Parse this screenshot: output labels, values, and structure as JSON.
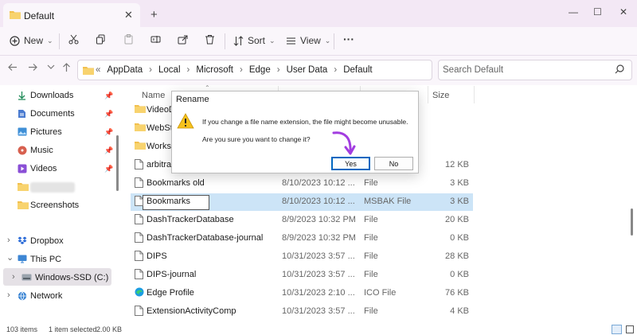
{
  "window": {
    "tab_title": "Default",
    "tab_close": "✕",
    "tab_add": "+",
    "minimize": "—",
    "maximize": "☐",
    "close": "✕"
  },
  "toolbar": {
    "new_label": "New",
    "sort_label": "Sort",
    "view_label": "View",
    "more_label": "···",
    "dropdown_chevron": "⌄"
  },
  "address": {
    "overflow": "«",
    "separator": "›",
    "crumbs": [
      "AppData",
      "Local",
      "Microsoft",
      "Edge",
      "User Data",
      "Default"
    ],
    "search_placeholder": "Search Default"
  },
  "nav": {
    "quick_access": [
      "Downloads",
      "Documents",
      "Pictures",
      "Music",
      "Videos",
      "",
      "Screenshots"
    ],
    "dropbox": "Dropbox",
    "this_pc": "This PC",
    "drive": "Windows-SSD (C:)",
    "network": "Network",
    "expand_glyph": "›",
    "expanded_glyph": "⌄",
    "pin_glyph": "📌"
  },
  "columns": {
    "name": "Name",
    "size": "Size"
  },
  "files": [
    {
      "name": "VideoD",
      "date": "",
      "type": "",
      "size": "",
      "icon": "folder-icon"
    },
    {
      "name": "WebSto",
      "date": "",
      "type": "",
      "size": "",
      "icon": "folder-icon"
    },
    {
      "name": "Worksp",
      "date": "",
      "type": "",
      "size": "",
      "icon": "folder-icon"
    },
    {
      "name": "arbitrat",
      "date": "",
      "type": "",
      "size": "12 KB",
      "icon": "file-icon"
    },
    {
      "name": "Bookmarks old",
      "date": "8/10/2023 10:12 ...",
      "type": "File",
      "size": "3 KB",
      "icon": "file-icon"
    },
    {
      "name": "Bookmarks",
      "date": "8/10/2023 10:12 ...",
      "type": "MSBAK File",
      "size": "3 KB",
      "icon": "file-icon"
    },
    {
      "name": "DashTrackerDatabase",
      "date": "8/9/2023 10:32 PM",
      "type": "File",
      "size": "20 KB",
      "icon": "file-icon"
    },
    {
      "name": "DashTrackerDatabase-journal",
      "date": "8/9/2023 10:32 PM",
      "type": "File",
      "size": "0 KB",
      "icon": "file-icon"
    },
    {
      "name": "DIPS",
      "date": "10/31/2023 3:57 ...",
      "type": "File",
      "size": "28 KB",
      "icon": "file-icon"
    },
    {
      "name": "DIPS-journal",
      "date": "10/31/2023 3:57 ...",
      "type": "File",
      "size": "0 KB",
      "icon": "file-icon"
    },
    {
      "name": "Edge Profile",
      "date": "10/31/2023 2:10 ...",
      "type": "ICO File",
      "size": "76 KB",
      "icon": "edge-icon"
    },
    {
      "name": "ExtensionActivityComp",
      "date": "10/31/2023 3:57 ...",
      "type": "File",
      "size": "4 KB",
      "icon": "file-icon"
    }
  ],
  "status": {
    "items": "103 items",
    "selected": "1 item selected",
    "selected_size": "2.00 KB"
  },
  "dialog": {
    "title": "Rename",
    "message1": "If you change a file name extension, the file might become unusable.",
    "message2": "Are you sure you want to change it?",
    "yes": "Yes",
    "no": "No"
  },
  "colors": {
    "accent": "#0067c0",
    "selection": "#cce4f7",
    "titlebar": "#f3e8f5",
    "folder": "#f2c04e",
    "arrow_annotation": "#a23de0"
  }
}
